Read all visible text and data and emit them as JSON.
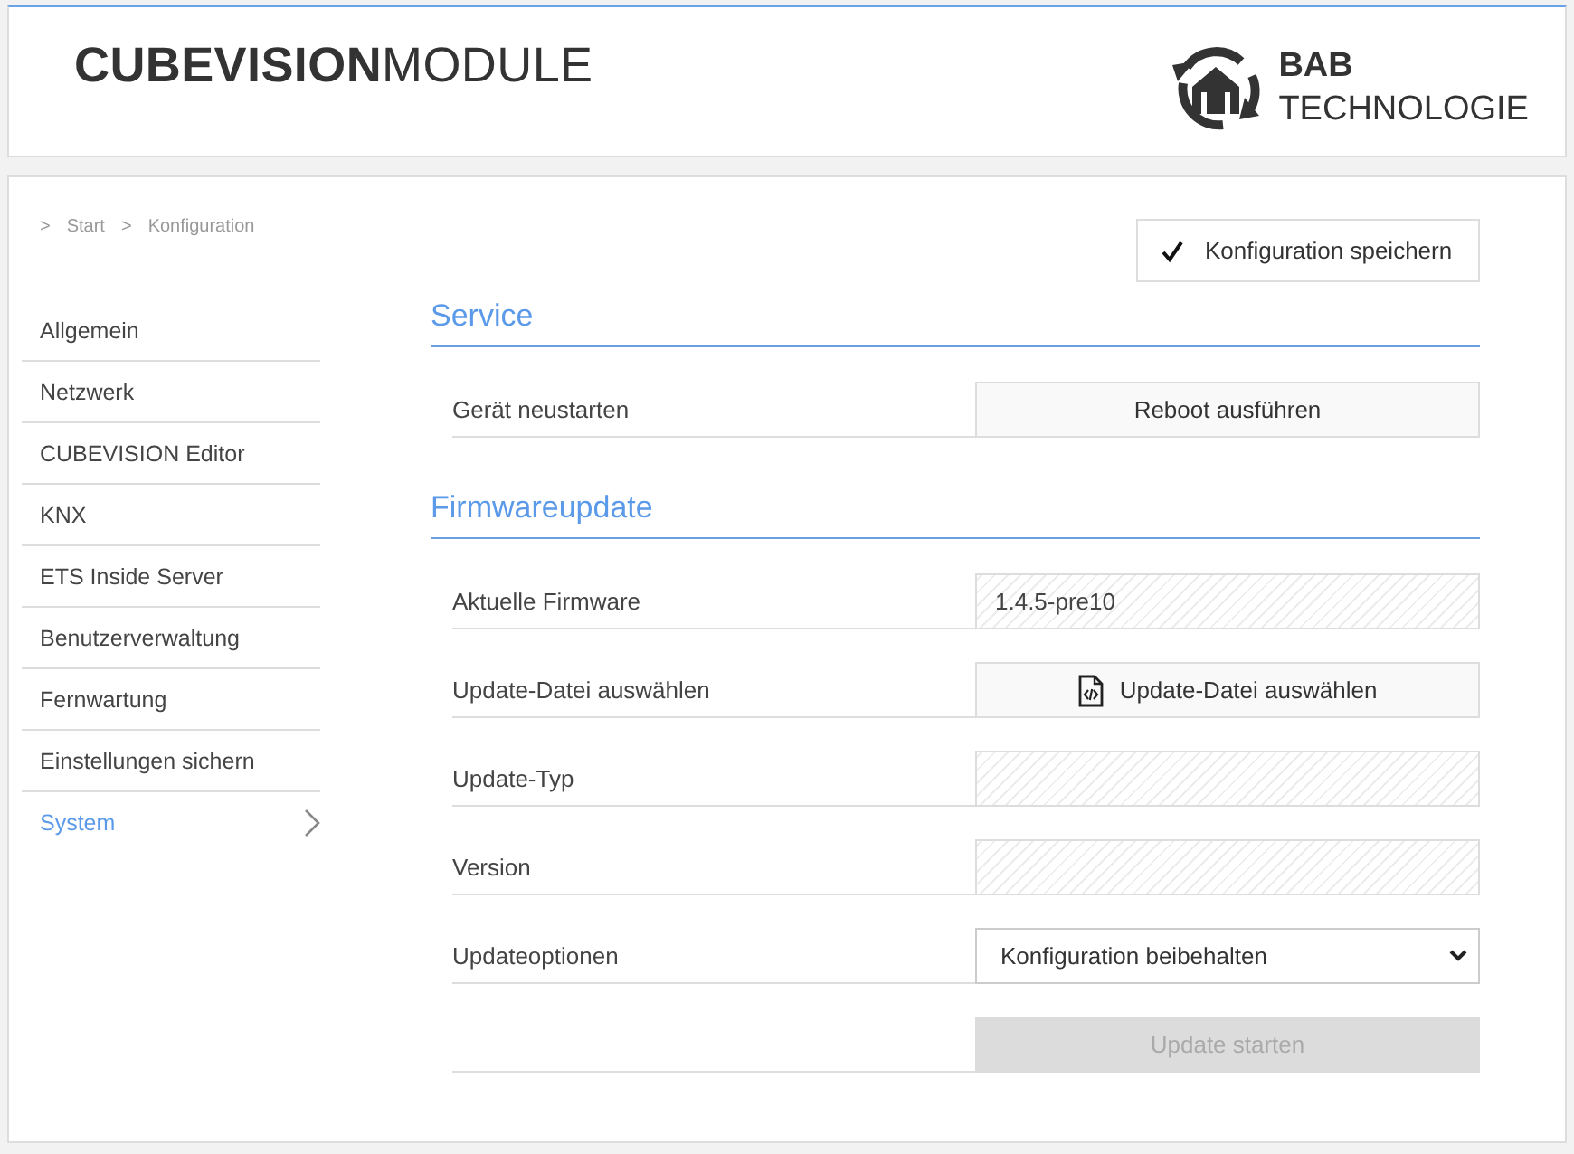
{
  "header": {
    "title": "**CUBEVISION**MODULE",
    "logo": {
      "line1": "BAB",
      "line2": "TECHNOLOGIE"
    }
  },
  "breadcrumb": [
    {
      "separator": ">",
      "label": "Start"
    },
    {
      "separator": ">",
      "label": "Konfiguration"
    }
  ],
  "sidebar": {
    "items": [
      {
        "label": "Allgemein",
        "selected": false
      },
      {
        "label": "Netzwerk",
        "selected": false
      },
      {
        "label": "CUBEVISION Editor",
        "selected": false
      },
      {
        "label": "KNX",
        "selected": false
      },
      {
        "label": "ETS Inside Server",
        "selected": false
      },
      {
        "label": "Benutzerverwaltung",
        "selected": false
      },
      {
        "label": "Fernwartung",
        "selected": false
      },
      {
        "label": "Einstellungen sichern",
        "selected": false
      },
      {
        "label": "System",
        "selected": true
      }
    ]
  },
  "save_button": {
    "label": "Konfiguration speichern"
  },
  "sections": [
    {
      "title": "Service",
      "rows": [
        {
          "kind": "button",
          "label": "Gerät neustarten",
          "button": "Reboot ausführen",
          "disabled": false
        }
      ]
    },
    {
      "title": "Firmwareupdate",
      "rows": [
        {
          "kind": "readonly",
          "label": "Aktuelle Firmware",
          "value": "1.4.5-pre10"
        },
        {
          "kind": "file",
          "label": "Update-Datei auswählen",
          "button": "Update-Datei auswählen"
        },
        {
          "kind": "readonly",
          "label": "Update-Typ"
        },
        {
          "kind": "readonly",
          "label": "Version"
        },
        {
          "kind": "select",
          "label": "Updateoptionen",
          "value": "Konfiguration beibehalten"
        },
        {
          "kind": "button",
          "button": "Update starten",
          "disabled": true
        }
      ]
    }
  ]
}
